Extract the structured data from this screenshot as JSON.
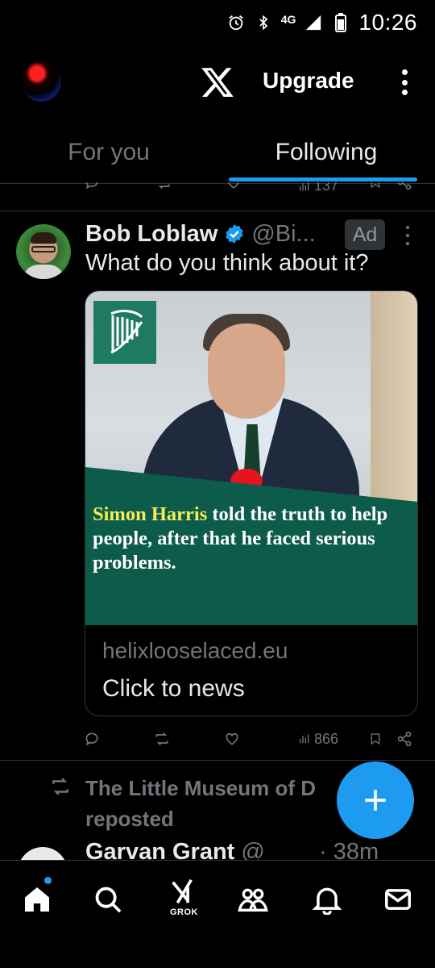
{
  "status_bar": {
    "network": "4G",
    "time": "10:26"
  },
  "top_bar": {
    "upgrade_label": "Upgrade"
  },
  "tabs": [
    {
      "label": "For you",
      "active": false
    },
    {
      "label": "Following",
      "active": true
    }
  ],
  "previous_tweet": {
    "views": "137"
  },
  "ad_tweet": {
    "name": "Bob Loblaw",
    "handle": "@Bi...",
    "ad_label": "Ad",
    "text": "What do you think about it?",
    "card": {
      "image_text_highlight": "Simon Harris",
      "image_text_rest": " told the truth to help people, after that he faced serious problems.",
      "domain": "helixlooselaced.eu",
      "title": "Click to news"
    },
    "views": "866"
  },
  "repost": {
    "text": "The Little Museum of D... reposted",
    "text_line1": "The Little Museum of D",
    "text_line2": "reposted"
  },
  "next_tweet": {
    "name": "Garvan Grant",
    "handle": "@",
    "time": "· 38m"
  },
  "bottom_nav": {
    "grok_label": "GROK",
    "items": [
      "home-icon",
      "search-icon",
      "grok-icon",
      "communities-icon",
      "notifications-icon",
      "messages-icon"
    ]
  },
  "colors": {
    "accent": "#1d9bf0",
    "background": "#000000",
    "muted": "#71767b",
    "card_band": "#0d5b4b",
    "highlight": "#f6ee52"
  }
}
